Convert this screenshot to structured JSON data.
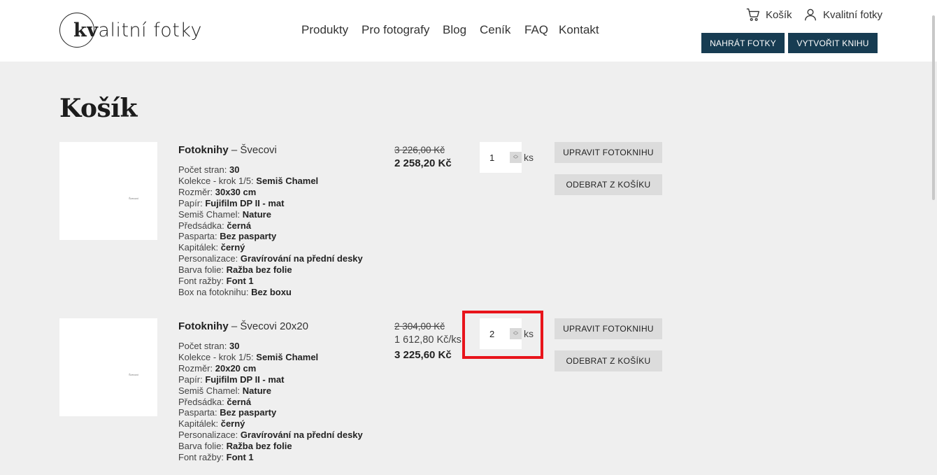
{
  "header": {
    "logo_prefix": "kv",
    "logo_rest": "alitní fotky",
    "nav": [
      "Produkty",
      "Pro fotografy",
      "Blog",
      "Ceník",
      "FAQ",
      "Kontakt"
    ],
    "cart_label": "Košík",
    "account_label": "Kvalitní fotky",
    "upload_button": "NAHRÁT FOTKY",
    "create_book_button": "VYTVOŘIT KNIHU",
    "brand_color": "#173c52"
  },
  "page_title": "Košík",
  "cart_items": [
    {
      "thumb_label": "Švecovi",
      "category": "Fotoknihy",
      "separator": "–",
      "name": "Švecovi",
      "specs": [
        {
          "label": "Počet stran:",
          "value": "30"
        },
        {
          "label": "Kolekce - krok 1/5:",
          "value": "Semiš Chamel"
        },
        {
          "label": "Rozměr:",
          "value": "30x30 cm"
        },
        {
          "label": "Papír:",
          "value": "Fujifilm DP II - mat"
        },
        {
          "label": "Semiš Chamel:",
          "value": "Nature"
        },
        {
          "label": "Předsádka:",
          "value": "černá"
        },
        {
          "label": "Pasparta:",
          "value": "Bez pasparty"
        },
        {
          "label": "Kapitálek:",
          "value": "černý"
        },
        {
          "label": "Personalizace:",
          "value": "Gravírování na přední desky"
        },
        {
          "label": "Barva folie:",
          "value": "Ražba bez folie"
        },
        {
          "label": "Font ražby:",
          "value": "Font 1"
        },
        {
          "label": "Box na fotoknihu:",
          "value": "Bez boxu"
        }
      ],
      "price_old": "3 226,00 Kč",
      "price_unit": "",
      "price_total": "2 258,20 Kč",
      "quantity": "1",
      "quantity_unit": "ks",
      "edit_button": "UPRAVIT FOTOKNIHU",
      "remove_button": "ODEBRAT Z KOŠÍKU"
    },
    {
      "thumb_label": "Švecovi",
      "category": "Fotoknihy",
      "separator": "–",
      "name": "Švecovi 20x20",
      "specs": [
        {
          "label": "Počet stran:",
          "value": "30"
        },
        {
          "label": "Kolekce - krok 1/5:",
          "value": "Semiš Chamel"
        },
        {
          "label": "Rozměr:",
          "value": "20x20 cm"
        },
        {
          "label": "Papír:",
          "value": "Fujifilm DP II - mat"
        },
        {
          "label": "Semiš Chamel:",
          "value": "Nature"
        },
        {
          "label": "Předsádka:",
          "value": "černá"
        },
        {
          "label": "Pasparta:",
          "value": "Bez pasparty"
        },
        {
          "label": "Kapitálek:",
          "value": "černý"
        },
        {
          "label": "Personalizace:",
          "value": "Gravírování na přední desky"
        },
        {
          "label": "Barva folie:",
          "value": "Ražba bez folie"
        },
        {
          "label": "Font ražby:",
          "value": "Font 1"
        }
      ],
      "price_old": "2 304,00 Kč",
      "price_unit": "1 612,80 Kč/ks",
      "price_total": "3 225,60 Kč",
      "quantity": "2",
      "quantity_unit": "ks",
      "edit_button": "UPRAVIT FOTOKNIHU",
      "remove_button": "ODEBRAT Z KOŠÍKU"
    }
  ],
  "highlight_color": "#e8141b"
}
